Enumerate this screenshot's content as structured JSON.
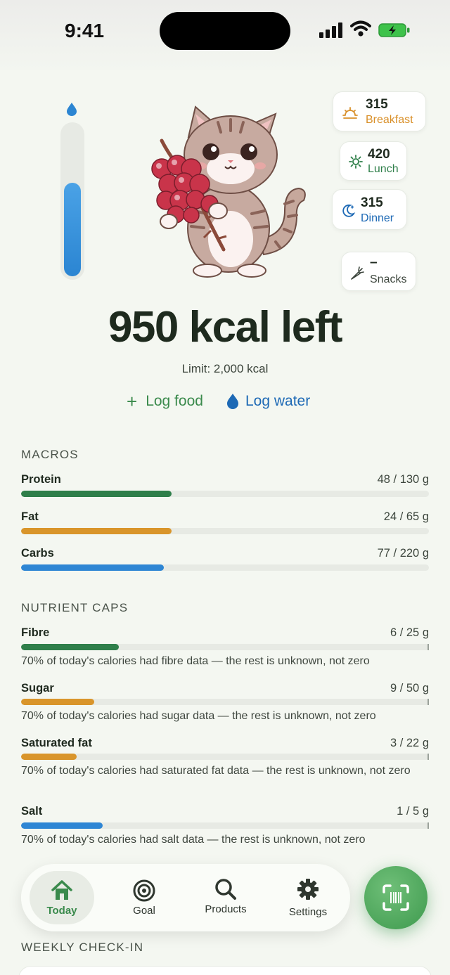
{
  "status_bar": {
    "time": "9:41"
  },
  "water": {
    "level_fraction": 0.62
  },
  "meals": [
    {
      "value": "315",
      "label": "Breakfast",
      "icon": "sunrise-icon",
      "color": "#d9902a"
    },
    {
      "value": "420",
      "label": "Lunch",
      "icon": "sun-icon",
      "color": "#2f7f4a"
    },
    {
      "value": "315",
      "label": "Dinner",
      "icon": "moon-icon",
      "color": "#1d69b5"
    },
    {
      "value": "–",
      "label": "Snacks",
      "icon": "carrot-icon",
      "color": "#3d463d"
    }
  ],
  "summary": {
    "headline": "950 kcal left",
    "limit": "Limit: 2,000 kcal"
  },
  "actions": {
    "log_food": "Log food",
    "log_water": "Log water"
  },
  "macros": {
    "title": "MACROS",
    "items": [
      {
        "name": "Protein",
        "value": "48 / 130 g",
        "fraction": 0.369,
        "color": "#2f7f4a"
      },
      {
        "name": "Fat",
        "value": "24 / 65 g",
        "fraction": 0.369,
        "color": "#d9952b"
      },
      {
        "name": "Carbs",
        "value": "77 / 220 g",
        "fraction": 0.35,
        "color": "#2e86d4"
      }
    ]
  },
  "nutrient_caps": {
    "title": "NUTRIENT CAPS",
    "items": [
      {
        "name": "Fibre",
        "value": "6 / 25 g",
        "fraction": 0.24,
        "color": "#2f7f4a",
        "note": "70% of today's calories had fibre data — the rest is unknown, not zero"
      },
      {
        "name": "Sugar",
        "value": "9 / 50 g",
        "fraction": 0.18,
        "color": "#d9952b",
        "note": "70% of today's calories had sugar data — the rest is unknown, not zero"
      },
      {
        "name": "Saturated fat",
        "value": "3 / 22 g",
        "fraction": 0.136,
        "color": "#d9952b",
        "note": "70% of today's calories had saturated fat data — the rest is unknown, not zero"
      },
      {
        "name": "Salt",
        "value": "1 / 5 g",
        "fraction": 0.2,
        "color": "#2e86d4",
        "note": "70% of today's calories had salt data — the rest is unknown, not zero"
      }
    ]
  },
  "tabs": [
    {
      "label": "Today",
      "icon": "home-icon",
      "active": true
    },
    {
      "label": "Goal",
      "icon": "target-icon",
      "active": false
    },
    {
      "label": "Products",
      "icon": "search-icon",
      "active": false
    },
    {
      "label": "Settings",
      "icon": "gear-icon",
      "active": false
    }
  ],
  "weekly": {
    "title": "WEEKLY CHECK-IN"
  }
}
